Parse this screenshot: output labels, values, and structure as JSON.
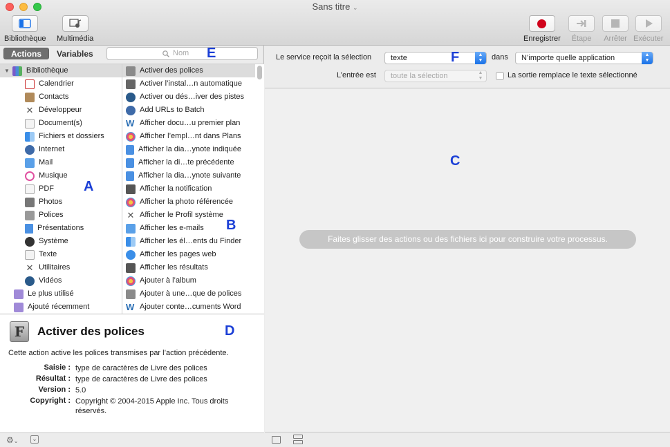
{
  "window": {
    "title": "Sans titre"
  },
  "toolbar": {
    "library": "Bibliothèque",
    "media": "Multimédia",
    "record": "Enregistrer",
    "step": "Étape",
    "stop": "Arrêter",
    "run": "Exécuter"
  },
  "tabs": {
    "actions": "Actions",
    "variables": "Variables"
  },
  "search": {
    "placeholder": "Nom"
  },
  "library": {
    "root": "Bibliothèque",
    "items": [
      "Calendrier",
      "Contacts",
      "Développeur",
      "Document(s)",
      "Fichiers et dossiers",
      "Internet",
      "Mail",
      "Musique",
      "PDF",
      "Photos",
      "Polices",
      "Présentations",
      "Système",
      "Texte",
      "Utilitaires",
      "Vidéos"
    ],
    "smart": [
      "Le plus utilisé",
      "Ajouté récemment"
    ]
  },
  "actions": [
    "Activer des polices",
    "Activer l’instal…n automatique",
    "Activer ou dés…iver des pistes",
    "Add URLs to Batch",
    "Afficher docu…u premier plan",
    "Afficher l’empl…nt dans Plans",
    "Afficher la dia…ynote indiquée",
    "Afficher la di…te précédente",
    "Afficher la dia…ynote suivante",
    "Afficher la notification",
    "Afficher la photo référencée",
    "Afficher le Profil système",
    "Afficher les e-mails",
    "Afficher les él…ents du Finder",
    "Afficher les pages web",
    "Afficher les résultats",
    "Ajouter à l’album",
    "Ajouter à une…que de polices",
    "Ajouter conte…cuments Word"
  ],
  "description": {
    "title": "Activer des polices",
    "text": "Cette action active les polices transmises par l’action précédente.",
    "input_label": "Saisie :",
    "input_value": "type de caractères de Livre des polices",
    "result_label": "Résultat :",
    "result_value": "type de caractères de Livre des polices",
    "version_label": "Version :",
    "version_value": "5.0",
    "copyright_label": "Copyright :",
    "copyright_value": "Copyright © 2004-2015 Apple Inc. Tous droits réservés."
  },
  "service": {
    "receives_label": "Le service reçoit la sélection",
    "receives_value": "texte",
    "in_label": "dans",
    "app_value": "N’importe quelle application",
    "input_is_label": "L’entrée est",
    "input_is_value": "toute la sélection",
    "replace_label": "La sortie remplace le texte sélectionné"
  },
  "workflow": {
    "hint": "Faites glisser des actions ou des fichiers ici pour construire votre processus."
  },
  "annotations": {
    "a": "A",
    "b": "B",
    "c": "C",
    "d": "D",
    "e": "E",
    "f": "F"
  },
  "colors": {
    "record": "#d0021b",
    "accent": "#1a72e8",
    "annotation": "#1b3fd6"
  }
}
